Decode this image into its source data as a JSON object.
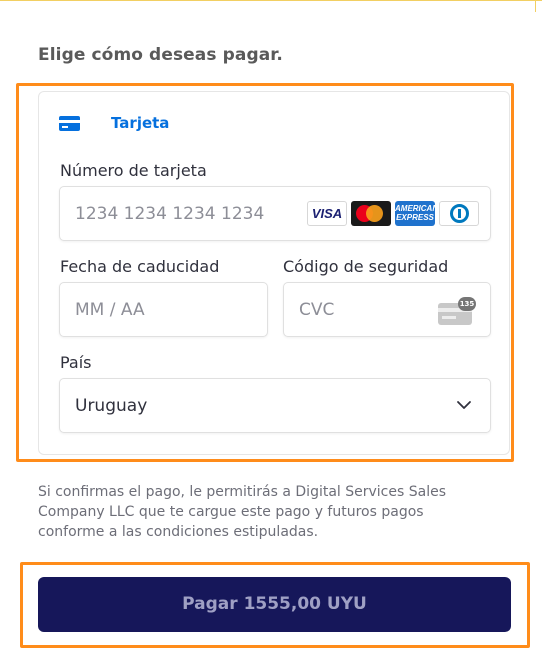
{
  "heading": "Elige cómo deseas pagar.",
  "tab": {
    "label": "Tarjeta",
    "icon": "credit-card-icon",
    "color": "#0570de"
  },
  "card_number": {
    "label": "Número de tarjeta",
    "placeholder": "1234 1234 1234 1234",
    "brands": [
      {
        "name": "visa-icon",
        "text": "VISA"
      },
      {
        "name": "mastercard-icon"
      },
      {
        "name": "amex-icon",
        "text": "AMERICAN EXPRESS"
      },
      {
        "name": "diners-icon"
      }
    ]
  },
  "expiry": {
    "label": "Fecha de caducidad",
    "placeholder": "MM / AA"
  },
  "security_code": {
    "label": "Código de seguridad",
    "placeholder": "CVC",
    "icon": "cvc-card-icon",
    "badge": "135"
  },
  "country": {
    "label": "País",
    "value": "Uruguay",
    "icon": "chevron-down-icon"
  },
  "consent_text": "Si confirmas el pago, le permitirás a Digital Services Sales Company LLC que te cargue este pago y futuros pagos conforme a las condiciones estipuladas.",
  "pay_button": {
    "label": "Pagar 1555,00 UYU",
    "background": "#16175a"
  },
  "highlight_color": "#ff8c1a"
}
